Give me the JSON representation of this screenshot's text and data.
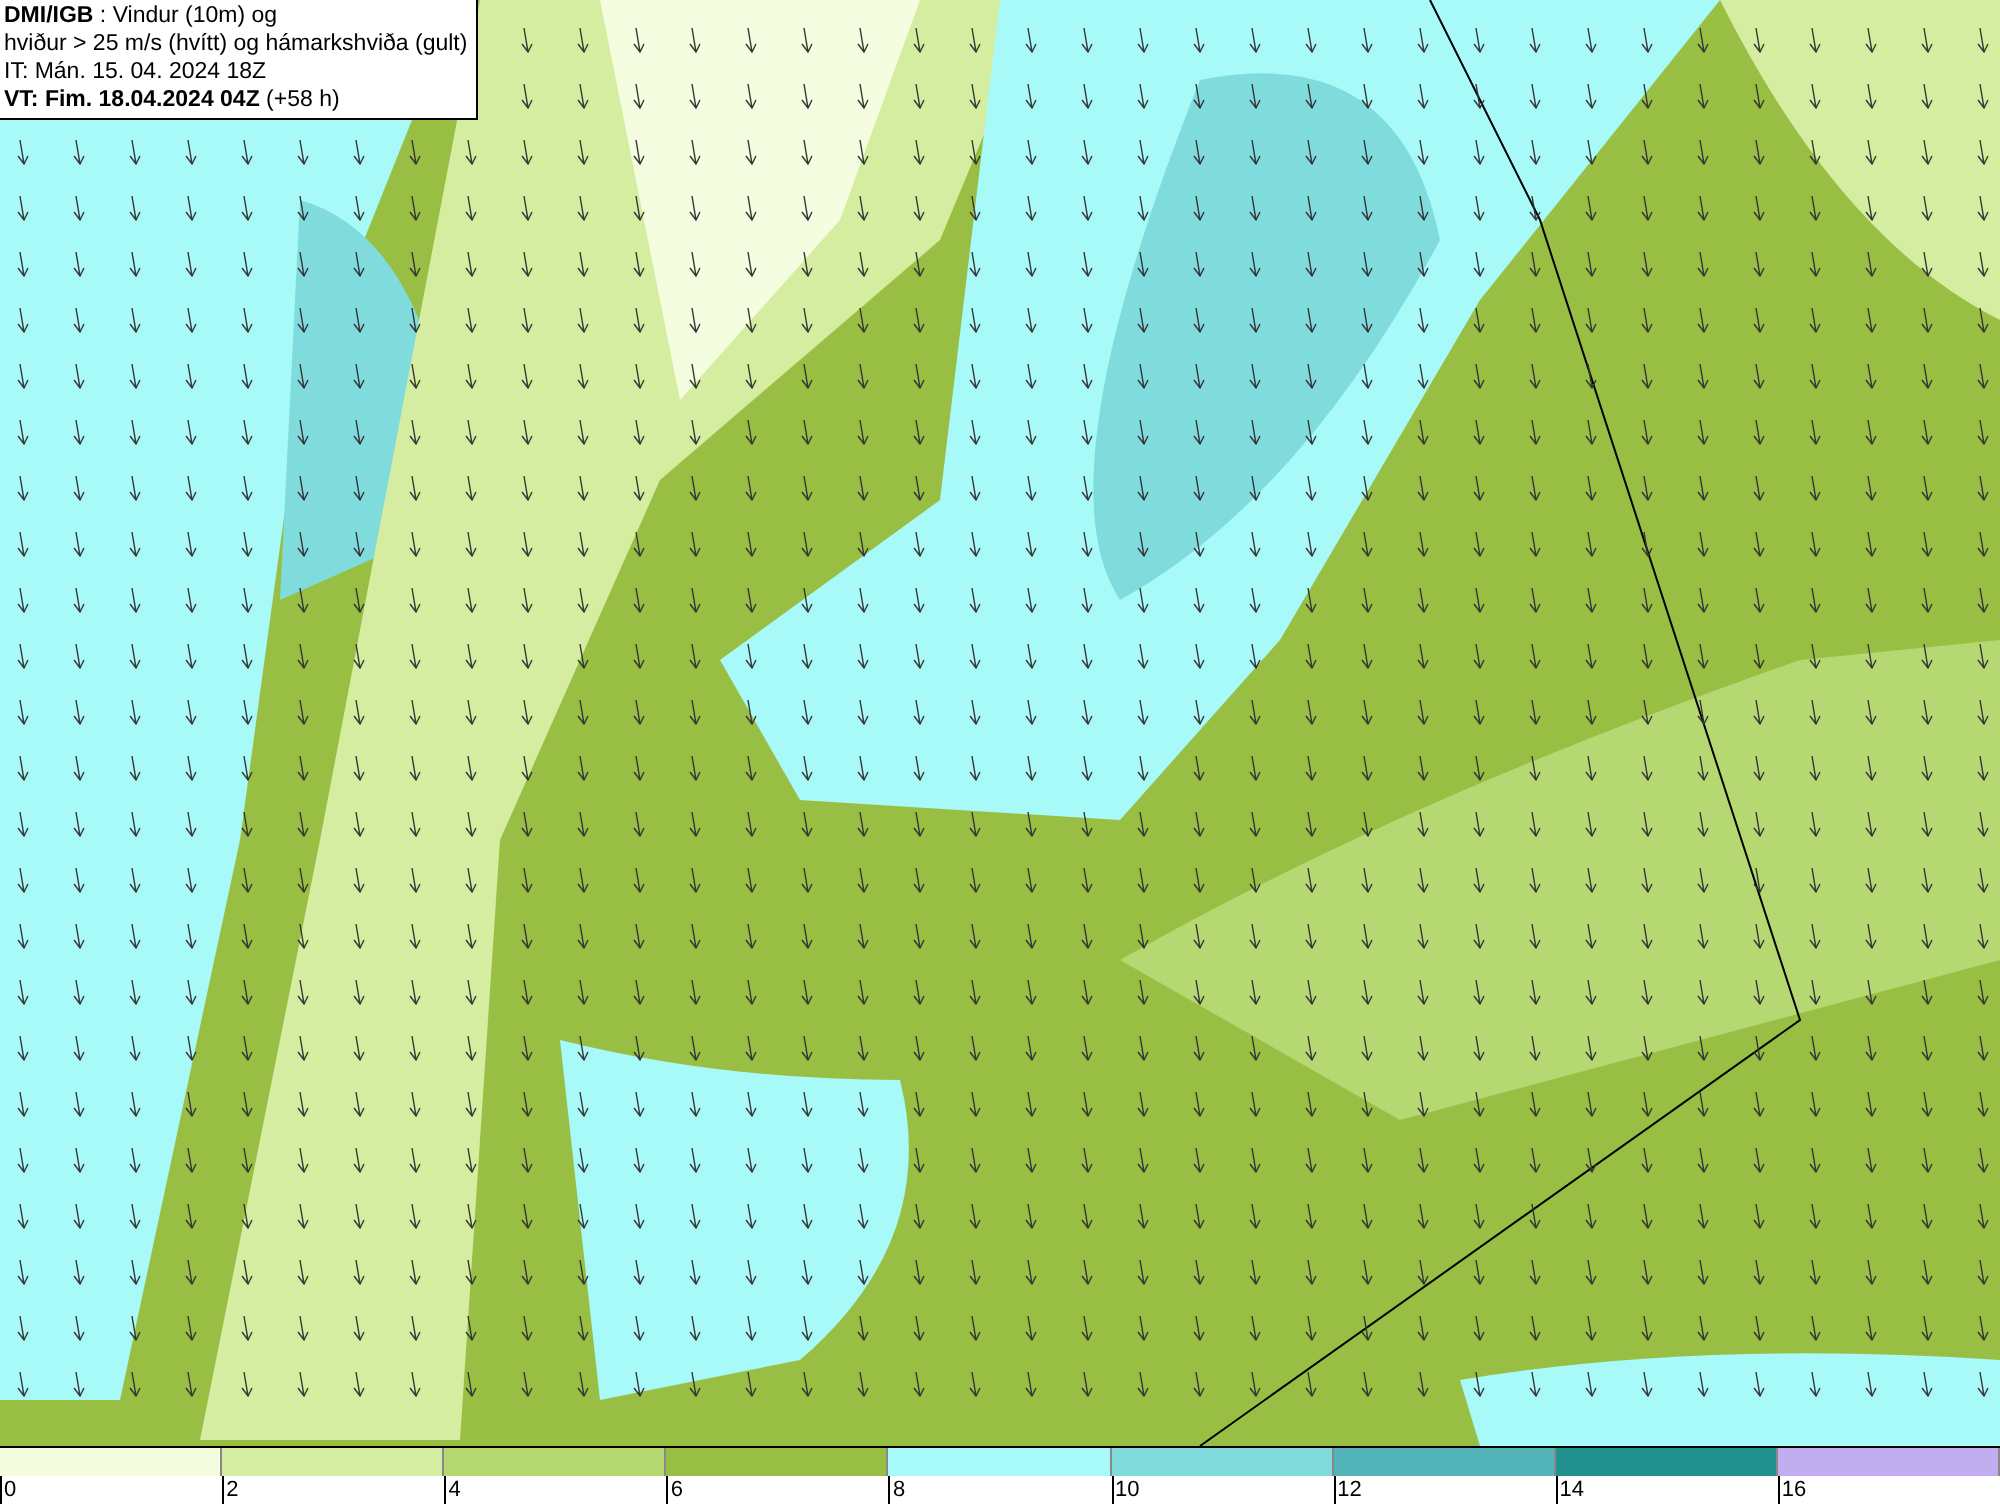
{
  "title_box": {
    "lines": [
      "**DMI/IGB** : Vindur (10m) og",
      "hviður > 25 m/s (hvítt) og hámarkshviða (gult)",
      "IT: Mán. 15. 04. 2024 18Z",
      "**VT: Fim. 18.04.2024 04Z** (+58 h)"
    ]
  },
  "legend": [
    {
      "label": "0",
      "color": "#f5fde0"
    },
    {
      "label": "2",
      "color": "#d4eda0"
    },
    {
      "label": "4",
      "color": "#b5d872"
    },
    {
      "label": "6",
      "color": "#98bf44"
    },
    {
      "label": "8",
      "color": "#a8faf8"
    },
    {
      "label": "10",
      "color": "#80dcdc"
    },
    {
      "label": "12",
      "color": "#52b4b8"
    },
    {
      "label": "14",
      "color": "#21918f"
    },
    {
      "label": "16",
      "color": "#c0aef0"
    }
  ]
}
